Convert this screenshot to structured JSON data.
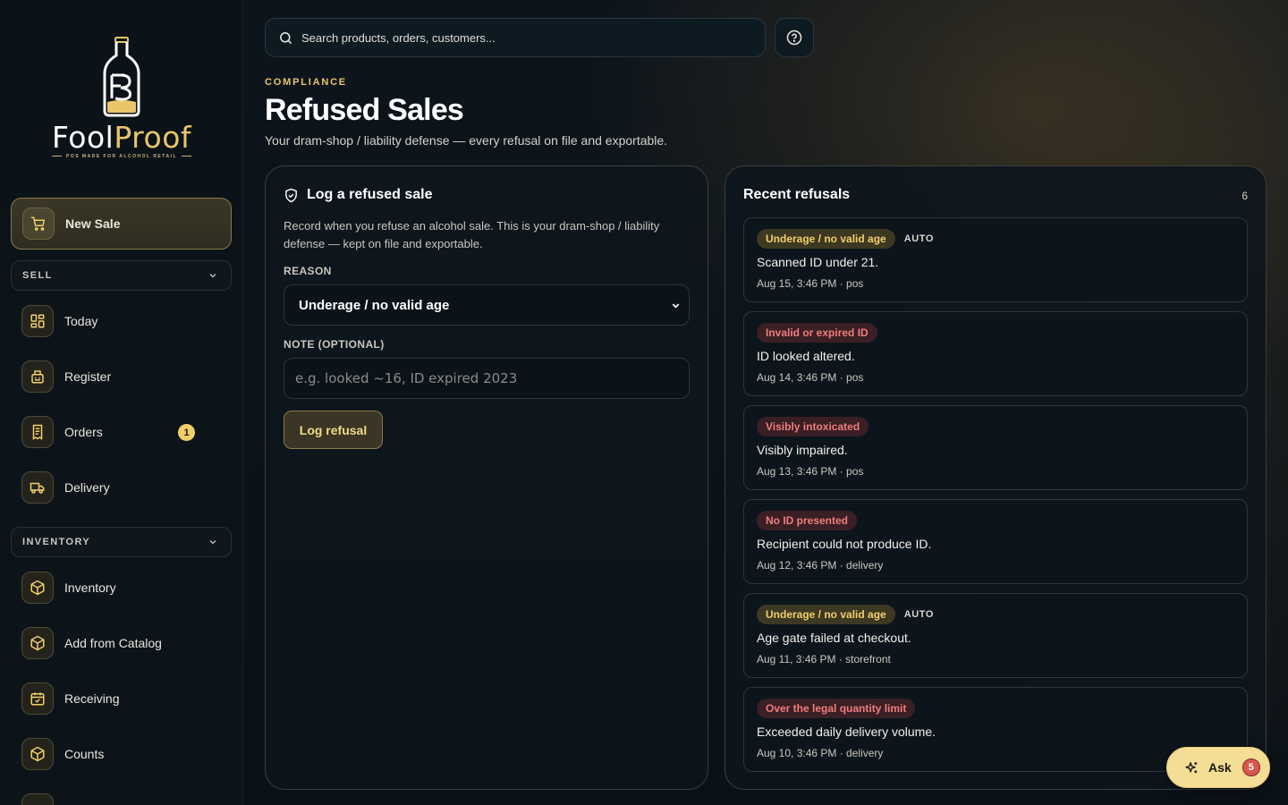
{
  "brand": {
    "name_part1": "Fool",
    "name_part2": "Proof",
    "tagline": "POS MADE FOR ALCOHOL RETAIL",
    "accent_color": "#e9c56a"
  },
  "sidebar": {
    "primary": {
      "label": "New Sale",
      "icon": "cart-icon"
    },
    "sections": [
      {
        "label": "SELL",
        "items": [
          {
            "label": "Today",
            "icon": "dashboard-icon"
          },
          {
            "label": "Register",
            "icon": "register-icon"
          },
          {
            "label": "Orders",
            "icon": "receipt-icon",
            "badge": "1"
          },
          {
            "label": "Delivery",
            "icon": "truck-icon"
          }
        ]
      },
      {
        "label": "INVENTORY",
        "items": [
          {
            "label": "Inventory",
            "icon": "box-icon"
          },
          {
            "label": "Add from Catalog",
            "icon": "box-icon"
          },
          {
            "label": "Receiving",
            "icon": "calendar-check-icon"
          },
          {
            "label": "Counts",
            "icon": "box-icon"
          }
        ]
      }
    ]
  },
  "search": {
    "placeholder": "Search products, orders, customers...",
    "icon": "search-icon"
  },
  "help": {
    "icon": "help-icon"
  },
  "header": {
    "eyebrow": "COMPLIANCE",
    "title": "Refused Sales",
    "subtitle": "Your dram-shop / liability defense — every refusal on file and exportable."
  },
  "log_form": {
    "title": "Log a refused sale",
    "icon": "shield-check-icon",
    "description": "Record when you refuse an alcohol sale. This is your dram-shop / liability defense — kept on file and exportable.",
    "reason_label": "REASON",
    "reason_value": "Underage / no valid age",
    "note_label": "NOTE (OPTIONAL)",
    "note_placeholder": "e.g. looked ~16, ID expired 2023",
    "submit_label": "Log refusal"
  },
  "recent": {
    "title": "Recent refusals",
    "count": "6",
    "items": [
      {
        "reason": "Underage / no valid age",
        "tone": "yellow",
        "auto": "AUTO",
        "text": "Scanned ID under 21.",
        "meta": "Aug 15, 3:46 PM · pos"
      },
      {
        "reason": "Invalid or expired ID",
        "tone": "red",
        "auto": "",
        "text": "ID looked altered.",
        "meta": "Aug 14, 3:46 PM · pos"
      },
      {
        "reason": "Visibly intoxicated",
        "tone": "red",
        "auto": "",
        "text": "Visibly impaired.",
        "meta": "Aug 13, 3:46 PM · pos"
      },
      {
        "reason": "No ID presented",
        "tone": "red",
        "auto": "",
        "text": "Recipient could not produce ID.",
        "meta": "Aug 12, 3:46 PM · delivery"
      },
      {
        "reason": "Underage / no valid age",
        "tone": "yellow",
        "auto": "AUTO",
        "text": "Age gate failed at checkout.",
        "meta": "Aug 11, 3:46 PM · storefront"
      },
      {
        "reason": "Over the legal quantity limit",
        "tone": "red",
        "auto": "",
        "text": "Exceeded daily delivery volume.",
        "meta": "Aug 10, 3:46 PM · delivery"
      }
    ]
  },
  "ask": {
    "label": "Ask",
    "badge": "5",
    "icon": "sparkle-icon"
  }
}
